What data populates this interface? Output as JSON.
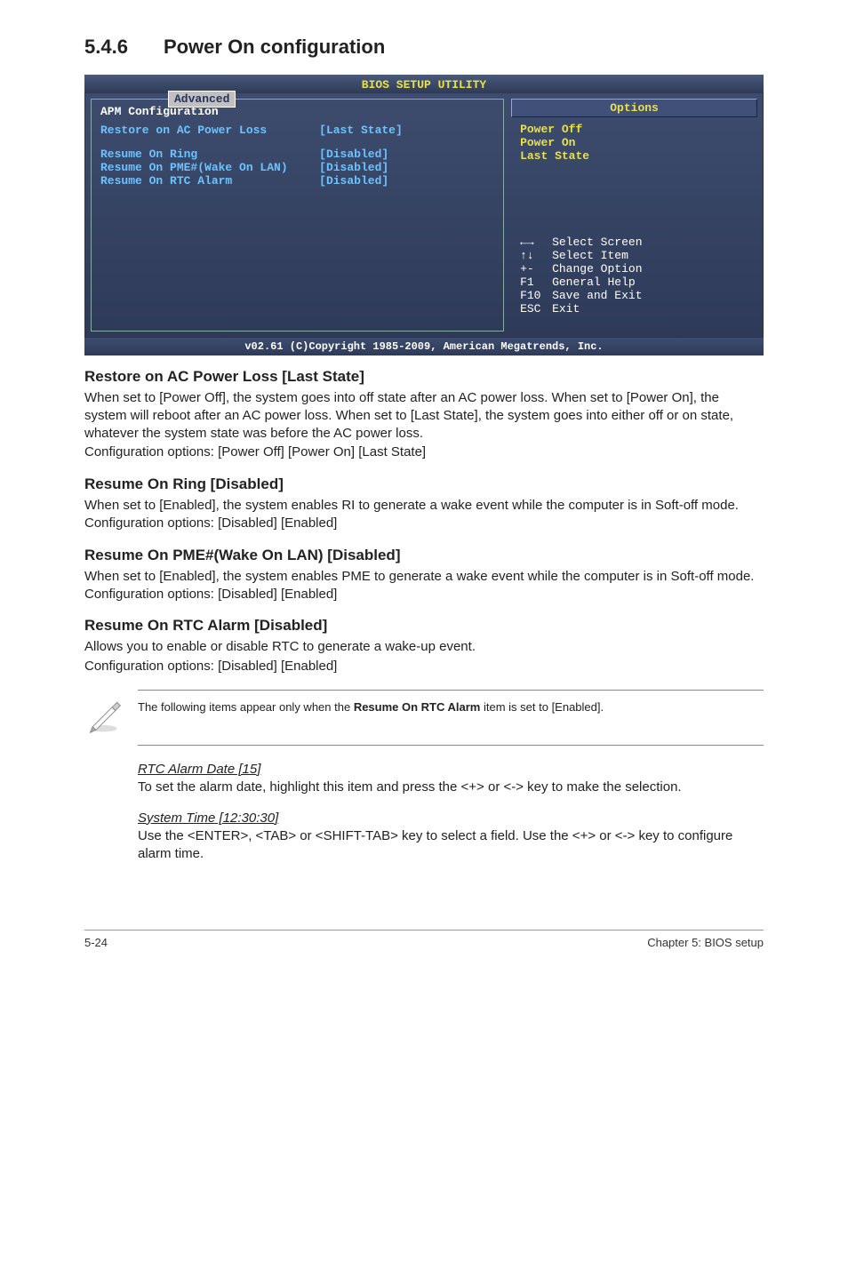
{
  "section": {
    "number": "5.4.6",
    "title": "Power On configuration"
  },
  "bios": {
    "utility_title": "BIOS SETUP UTILITY",
    "tab": "Advanced",
    "panel_title": "APM Configuration",
    "rows": [
      {
        "k": "Restore on AC Power Loss",
        "v": "[Last State]",
        "spacer_after": true
      },
      {
        "k": "Resume On Ring",
        "v": "[Disabled]"
      },
      {
        "k": "Resume On PME#(Wake On LAN)",
        "v": "[Disabled]"
      },
      {
        "k": "Resume On RTC Alarm",
        "v": "[Disabled]"
      }
    ],
    "options_header": "Options",
    "options": [
      "Power Off",
      "Power On",
      "Last State"
    ],
    "help": [
      {
        "key": "←→",
        "label": "Select Screen"
      },
      {
        "key": "↑↓",
        "label": "Select Item"
      },
      {
        "key": "+-",
        "label": "Change Option"
      },
      {
        "key": "F1",
        "label": "General Help"
      },
      {
        "key": "F10",
        "label": "Save and Exit"
      },
      {
        "key": "ESC",
        "label": "Exit"
      }
    ],
    "footer": "v02.61 (C)Copyright 1985-2009, American Megatrends, Inc."
  },
  "s1": {
    "h": "Restore on AC Power Loss [Last State]",
    "p1": "When set to [Power Off], the system goes into off state after an AC power loss. When set to [Power On], the system will reboot after an AC power loss. When set to [Last State], the system goes into either off or on state, whatever the system state was before the AC power loss.",
    "p2": "Configuration options: [Power Off] [Power On] [Last State]"
  },
  "s2": {
    "h": "Resume On Ring [Disabled]",
    "p": "When set to [Enabled], the system enables RI to generate a wake event while the computer is in Soft-off mode. Configuration options: [Disabled] [Enabled]"
  },
  "s3": {
    "h": "Resume On PME#(Wake On LAN) [Disabled]",
    "p": "When set to [Enabled], the system enables PME to generate a wake event while the computer is in Soft-off mode. Configuration options: [Disabled] [Enabled]"
  },
  "s4": {
    "h": "Resume On RTC Alarm [Disabled]",
    "p1": "Allows you to enable or disable RTC to generate a wake-up event.",
    "p2": "Configuration options: [Disabled] [Enabled]"
  },
  "note": {
    "pre": "The following items appear only when the ",
    "bold": "Resume On RTC Alarm",
    "post": " item is set to [Enabled]."
  },
  "sub1": {
    "h": "RTC Alarm Date [15]",
    "p": "To set the alarm date, highlight this item and press the <+> or <-> key to make the selection."
  },
  "sub2": {
    "h": "System Time [12:30:30]",
    "p": "Use the <ENTER>, <TAB> or <SHIFT-TAB> key to select a field. Use the <+> or <-> key to configure alarm time."
  },
  "footer": {
    "left": "5-24",
    "right": "Chapter 5: BIOS setup"
  }
}
